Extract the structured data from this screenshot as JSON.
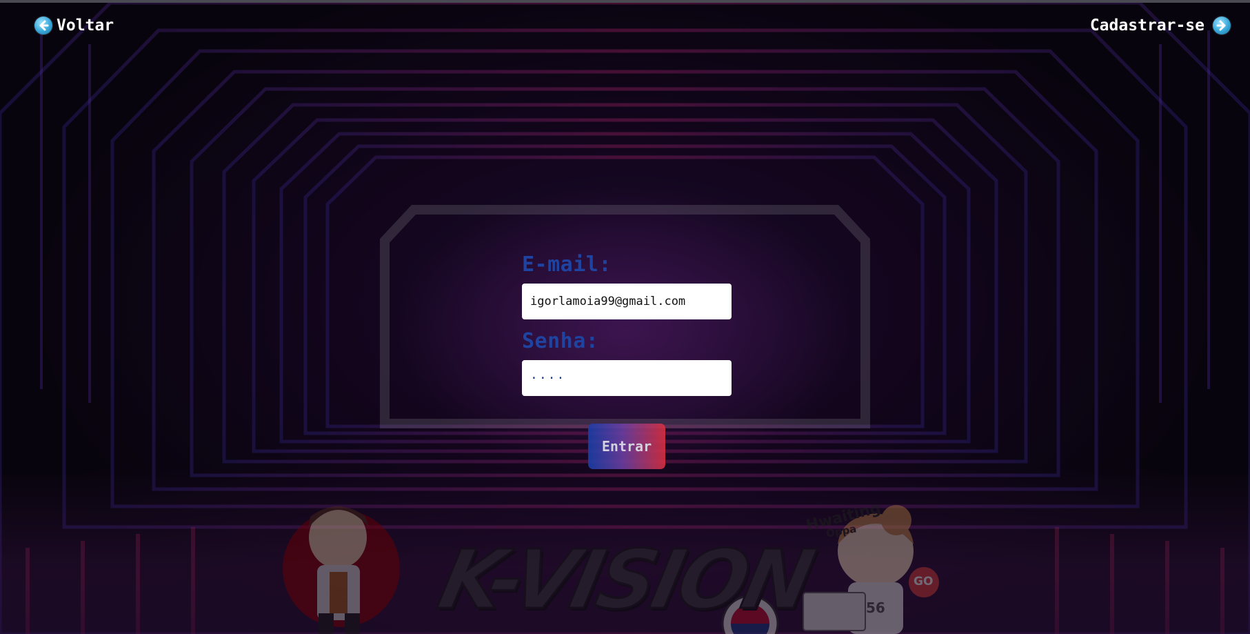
{
  "nav": {
    "back_label": "Voltar",
    "signup_label": "Cadastrar-se"
  },
  "form": {
    "email_label": "E-mail:",
    "email_value": "igorlamoia99@gmail.com",
    "password_label": "Senha:",
    "password_mask": "····",
    "submit_label": "Entrar"
  },
  "branding": {
    "logo_text": "K-VISION",
    "sticker_text_1": "Hwaiting",
    "sticker_text_2": "Oppa",
    "sticker_badge": "GO",
    "sticker_number": "56"
  },
  "colors": {
    "label_blue": "#1f43a0",
    "button_gradient_start": "#1a3fa8",
    "button_gradient_end": "#d83040",
    "nav_icon": "#36a7d8"
  }
}
